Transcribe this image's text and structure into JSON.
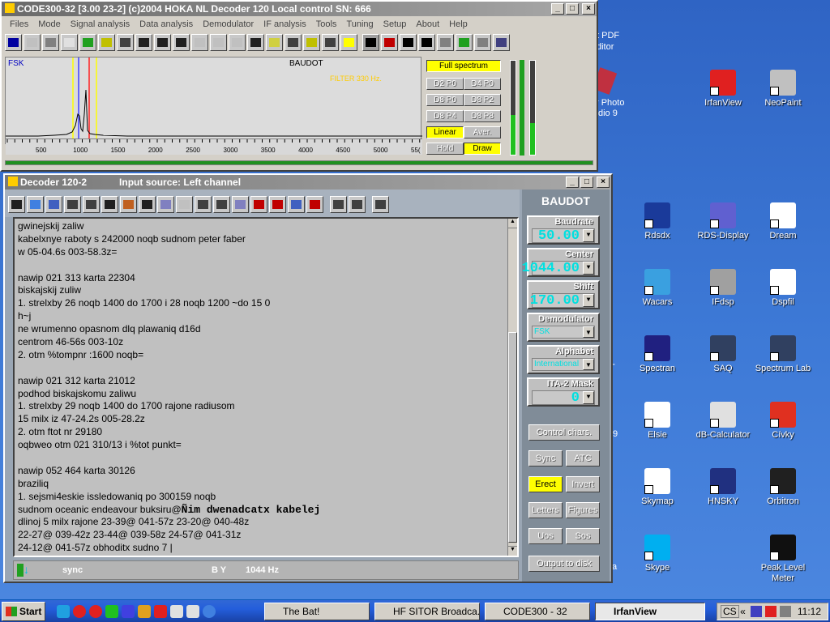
{
  "desktop": {
    "icons": [
      {
        "label": "IrfanView",
        "icon": "irfanview-icon",
        "color": "#e02020"
      },
      {
        "label": "NeoPaint",
        "icon": "neopaint-icon",
        "color": "#c0c0c0"
      },
      {
        "label": "Rdsdx",
        "icon": "rdsdx-icon",
        "color": "#1a3a9a"
      },
      {
        "label": "RDS-Display",
        "icon": "rds-display-icon",
        "color": "#6060d0"
      },
      {
        "label": "Dream",
        "icon": "dream-icon",
        "color": "#ffffff"
      },
      {
        "label": "Wacars",
        "icon": "wacars-icon",
        "color": "#3aa0e0"
      },
      {
        "label": "IFdsp",
        "icon": "ifdsp-icon",
        "color": "#a0a0a0"
      },
      {
        "label": "Dspfil",
        "icon": "dspfil-icon",
        "color": "#ffffff"
      },
      {
        "label": "Spectran",
        "icon": "spectran-icon",
        "color": "#202080"
      },
      {
        "label": "SAQ",
        "icon": "saq-icon",
        "color": "#304060"
      },
      {
        "label": "Spectrum Lab",
        "icon": "spectrum-lab-icon",
        "color": "#304060"
      },
      {
        "label": "Elsie",
        "icon": "elsie-icon",
        "color": "#ffffff"
      },
      {
        "label": "dB-Calculator",
        "icon": "db-calculator-icon",
        "color": "#e0e0e0"
      },
      {
        "label": "Cívky",
        "icon": "civky-icon",
        "color": "#e03020"
      },
      {
        "label": "Skymap",
        "icon": "skymap-icon",
        "color": "#ffffff"
      },
      {
        "label": "HNSKY",
        "icon": "hnsky-icon",
        "color": "#203080"
      },
      {
        "label": "Orbitron",
        "icon": "orbitron-icon",
        "color": "#202020"
      },
      {
        "label": "Skype",
        "icon": "skype-icon",
        "color": "#00aff0"
      },
      {
        "label": "Peak Level Meter",
        "icon": "peak-level-meter-icon",
        "color": "#101010"
      }
    ],
    "partial_labels": [
      "t PDF",
      "ditor",
      "r Photo",
      "dio 9",
      "T",
      "9",
      "a"
    ]
  },
  "main_window": {
    "title": "CODE300-32 [3.00 23-2] (c)2004 HOKA NL      Decoder 120         Local control       SN: 666",
    "menu": [
      "Files",
      "Mode",
      "Signal analysis",
      "Data analysis",
      "Demodulator",
      "IF analysis",
      "Tools",
      "Tuning",
      "Setup",
      "About",
      "Help"
    ],
    "spectrum": {
      "mode_label": "FSK",
      "decoder_label": "BAUDOT",
      "filter_label": "FILTER 330 Hz.",
      "ticks": [
        "500",
        "1000",
        "1500",
        "2000",
        "2500",
        "3000",
        "3500",
        "4000",
        "4500",
        "5000",
        "55("
      ]
    },
    "spectrum_buttons": [
      {
        "label": "Full spectrum",
        "active": true
      },
      {
        "label": "D2 P0",
        "active": false
      },
      {
        "label": "D4 P0",
        "active": false
      },
      {
        "label": "D8 P0",
        "active": false
      },
      {
        "label": "D8 P2",
        "active": false
      },
      {
        "label": "D8 P4",
        "active": false
      },
      {
        "label": "D8 P8",
        "active": false
      },
      {
        "label": "Linear",
        "active": true
      },
      {
        "label": "Aver.",
        "active": false
      },
      {
        "label": "Hold",
        "active": false
      },
      {
        "label": "Draw",
        "active": true
      }
    ]
  },
  "decoder_window": {
    "title": "Decoder 120-2",
    "source": "Input source: Left channel",
    "mode_header": "BAUDOT",
    "text_lines": [
      "gwinejskij zaliw",
      "kabelxnye raboty s 242000 noqb sudnom peter faber",
      "w 05-04.6s 003-58.3z=",
      "",
      "nawip 021 313 karta 22304",
      "biskajskij zuliw",
      "1. strelxby 26 noqb 1400 do 1700 i 28 noqb 1200 ~do 15 0",
      "h~j",
      "ne wrumenno opasnom dlq plawaniq d16d",
      "centrom 46-56s 003-10z",
      "2. otm %tompnr :1600 noqb=",
      "",
      "nawip 021 312 karta 21012",
      "podhod biskajskomu zaliwu",
      "1. strelxby 29 noqb 1400 do 1700 rajone radiusom",
      "15 milx iz 47-24.2s 005-28.2z",
      "2. otm ftot nr 29180",
      "oqbweo otm 021 310/13 i %tot punkt=",
      "",
      "nawip 052 464 karta 30126",
      "braziliq",
      "1. sejsmi4eskie issledowaniq po 300159 noqb",
      "sudnom oceanic endeavour buksiru@",
      "dlinoj 5 milx rajone 23-39@ 041-57z 23-20@ 040-48z",
      "22-27@ 039-42z 23-44@ 039-58z 24-57@ 041-31z",
      "24-12@ 041-57z obhoditx sudno 7 |"
    ],
    "bold_tail": "Ñim dwenadcatx kabelej",
    "status": {
      "sync": "sync",
      "by": "B Y",
      "freq": "1044 Hz"
    },
    "baudrate": {
      "label": "Baudrate",
      "value": "50.00"
    },
    "center": {
      "label": "Center",
      "value": "1044.00"
    },
    "shift": {
      "label": "Shift",
      "value": "170.00"
    },
    "demodulator": {
      "label": "Demodulator",
      "value": "FSK"
    },
    "alphabet": {
      "label": "Alphabet",
      "value": "International"
    },
    "ita2": {
      "label": "ITA-2 Mask",
      "value": "0"
    },
    "buttons": {
      "control_chars": "Control chars.",
      "sync": "Sync",
      "atc": "ATC",
      "erect": "Erect",
      "invert": "Invert",
      "letters": "Letters",
      "figures": "Figures",
      "uos": "Uos",
      "sos": "Sos",
      "output": "Output to disk"
    }
  },
  "taskbar": {
    "start": "Start",
    "tasks": [
      "The Bat!",
      "HF SITOR Broadca...",
      "CODE300 - 32",
      "IrfanView"
    ],
    "lang": "CS",
    "clock": "11:12"
  }
}
